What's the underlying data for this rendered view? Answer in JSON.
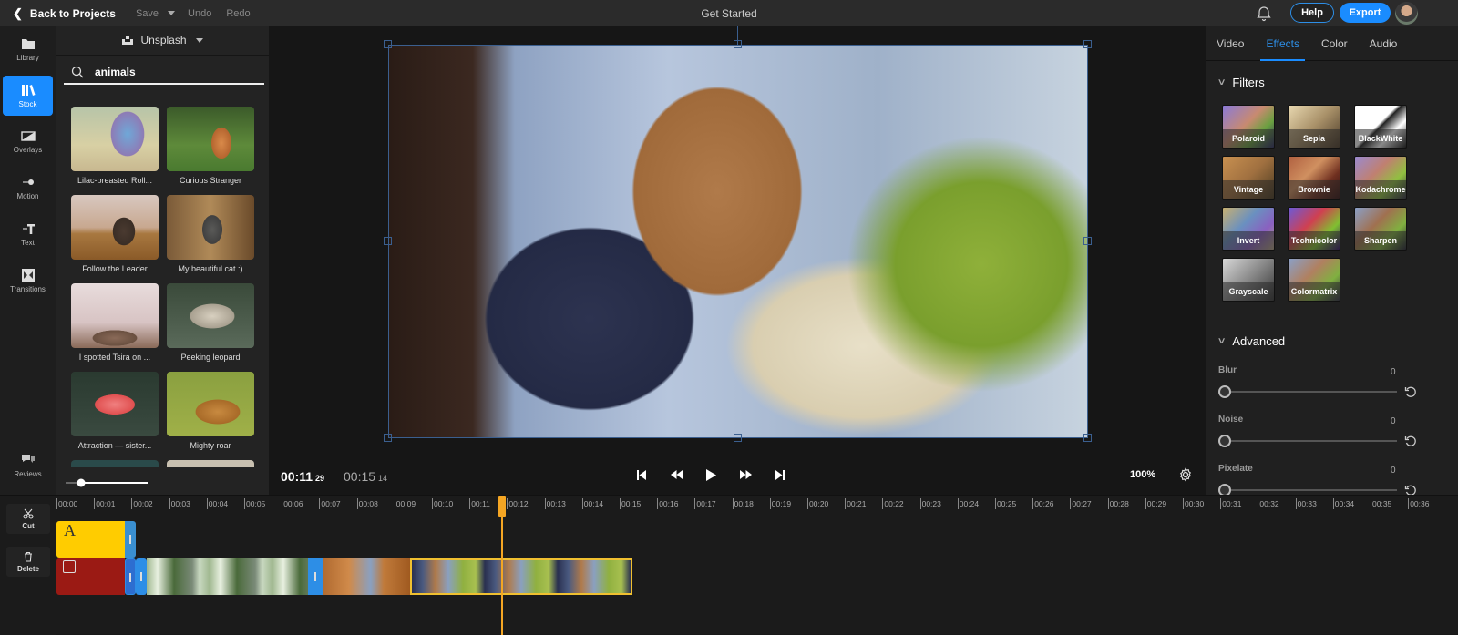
{
  "topbar": {
    "back_label": "Back to Projects",
    "save_label": "Save",
    "undo_label": "Undo",
    "redo_label": "Redo",
    "title": "Get Started",
    "help_label": "Help",
    "export_label": "Export"
  },
  "nav": {
    "items": [
      {
        "label": "Library",
        "icon": "folder-icon"
      },
      {
        "label": "Stock",
        "icon": "books-icon",
        "active": true
      },
      {
        "label": "Overlays",
        "icon": "overlay-icon"
      },
      {
        "label": "Motion",
        "icon": "motion-icon"
      },
      {
        "label": "Text",
        "icon": "text-icon"
      },
      {
        "label": "Transitions",
        "icon": "transitions-icon"
      },
      {
        "label": "Reviews",
        "icon": "chat-bubbles-icon"
      }
    ]
  },
  "stock": {
    "source_label": "Unsplash",
    "search_value": "animals",
    "search_placeholder": "Search",
    "items": [
      {
        "caption": "Lilac-breasted Roll..."
      },
      {
        "caption": "Curious Stranger"
      },
      {
        "caption": "Follow the Leader"
      },
      {
        "caption": "My beautiful cat :)"
      },
      {
        "caption": "I spotted Tsira on ..."
      },
      {
        "caption": "Peeking leopard"
      },
      {
        "caption": "Attraction — sister..."
      },
      {
        "caption": "Mighty roar"
      }
    ],
    "thumb_size_fraction": 0.2
  },
  "preview": {
    "current_time": "00:11",
    "current_frame": "29",
    "total_time": "00:15",
    "total_frame": "14",
    "zoom": "100%"
  },
  "right": {
    "tabs": [
      "Video",
      "Effects",
      "Color",
      "Audio"
    ],
    "active_tab": "Effects",
    "filters_title": "Filters",
    "filters": [
      "Polaroid",
      "Sepia",
      "BlackWhite",
      "Vintage",
      "Brownie",
      "Kodachrome",
      "Invert",
      "Technicolor",
      "Sharpen",
      "Grayscale",
      "Colormatrix"
    ],
    "advanced_title": "Advanced",
    "advanced": [
      {
        "label": "Blur",
        "value": "0"
      },
      {
        "label": "Noise",
        "value": "0"
      },
      {
        "label": "Pixelate",
        "value": "0"
      }
    ]
  },
  "timeline": {
    "tools": [
      {
        "label": "Cut",
        "icon": "scissors-icon"
      },
      {
        "label": "Delete",
        "icon": "trash-icon"
      }
    ],
    "ticks": [
      "00:00",
      "00:01",
      "00:02",
      "00:03",
      "00:04",
      "00:05",
      "00:06",
      "00:07",
      "00:08",
      "00:09",
      "00:10",
      "00:11",
      "00:12",
      "00:13",
      "00:14",
      "00:15",
      "00:16",
      "00:17",
      "00:18",
      "00:19",
      "00:20",
      "00:21",
      "00:22",
      "00:23",
      "00:24",
      "00:25",
      "00:26",
      "00:27",
      "00:28",
      "00:29",
      "00:30",
      "00:31",
      "00:32",
      "00:33",
      "00:34",
      "00:35",
      "00:36"
    ],
    "text_clip_glyph": "A",
    "playhead_seconds": 11.9,
    "colors": {
      "text_clip": "#ffcc00",
      "color_clip": "#9b1a14",
      "transition": "#2d8ee6",
      "selected_border": "#f0c030",
      "playhead": "#f5a623",
      "accent": "#1a8cff"
    }
  }
}
